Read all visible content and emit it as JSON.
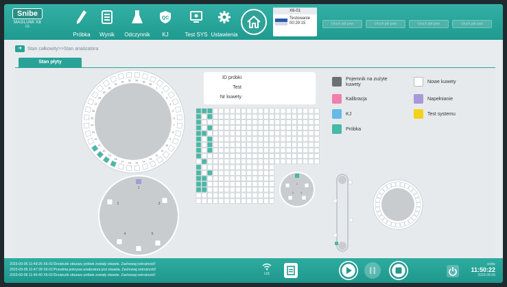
{
  "app": {
    "logo": "Snibe",
    "model": "MAGLUMI X8",
    "model_sub": "CE"
  },
  "nav": [
    {
      "id": "probka",
      "label": "Próbka",
      "icon": "pencil-icon"
    },
    {
      "id": "wynik",
      "label": "Wynik",
      "icon": "document-list-icon"
    },
    {
      "id": "odczynnik",
      "label": "Odczynnik",
      "icon": "flask-icon"
    },
    {
      "id": "kj",
      "label": "KJ",
      "icon": "qc-shield-icon"
    },
    {
      "id": "testsys",
      "label": "Test SYS",
      "icon": "monitor-icon"
    },
    {
      "id": "ustawienia",
      "label": "Ustawienia",
      "icon": "gear-icon"
    }
  ],
  "status_card": {
    "title": "X6-01",
    "state": "Testowanie",
    "time": "00:29:15"
  },
  "ghost_buttons": [
    "Uruch pół pow",
    "Uruch pół pow",
    "Uruch pół pow",
    "Uruch pół pow"
  ],
  "breadcrumb": "Stan całkowity>>Stan analizatora",
  "tab": "Stan płyty",
  "info": {
    "sample_id": "ID próbki",
    "test": "Test",
    "cuvette_no": "Nr kuwety"
  },
  "legend": [
    {
      "label": "Pojemnik na zużyte kuwety",
      "color": "#6d7073"
    },
    {
      "label": "Kalibracja",
      "color": "#ef80ab"
    },
    {
      "label": "KJ",
      "color": "#66b9e8"
    },
    {
      "label": "Próbka",
      "color": "#47b9a6"
    },
    {
      "label": "Nowe kuwety",
      "color": "#ffffff"
    },
    {
      "label": "Napełnianie",
      "color": "#a69ad8"
    },
    {
      "label": "Test systemu",
      "color": "#f2d21b"
    }
  ],
  "reagent_numbers": [
    "1",
    "2",
    "3",
    "4",
    "5",
    "6",
    "7",
    "8",
    "9",
    "10",
    "11",
    "12",
    "13",
    "14",
    "15",
    "16",
    "17",
    "18",
    "19",
    "20",
    "21",
    "22",
    "23",
    "24",
    "25",
    "26",
    "27",
    "28",
    "29",
    "30",
    "31",
    "32",
    "33",
    "34",
    "35",
    "36"
  ],
  "sample_disc_labels": [
    "1",
    "2",
    "3",
    "4",
    "5"
  ],
  "small_disc_labels": [
    "1",
    "2",
    "3"
  ],
  "messages": [
    "2023-09-06 11:49:25  X6-01!Drzwiczki obszaru próbek zostały otwarte. Zachowaj ostrożność!",
    "2023-09-06 11:47:28  X6-01!Przednia pokrywa analizatora jest otwarta. Zachowaj ostrożność!",
    "2023-09-06 11:46:40  X6-01!Drzwiczki obszaru próbek zostały otwarte. Zachowaj ostrożność!"
  ],
  "lis": "LIS",
  "footer": {
    "user": "snibe",
    "time": "11:50:22",
    "date": "2023-09-06"
  },
  "colors": {
    "teal": "#29a397",
    "cell_border": "#b8c0c6",
    "cell_fill": "#ffffff",
    "sample": "#47b9a6"
  }
}
